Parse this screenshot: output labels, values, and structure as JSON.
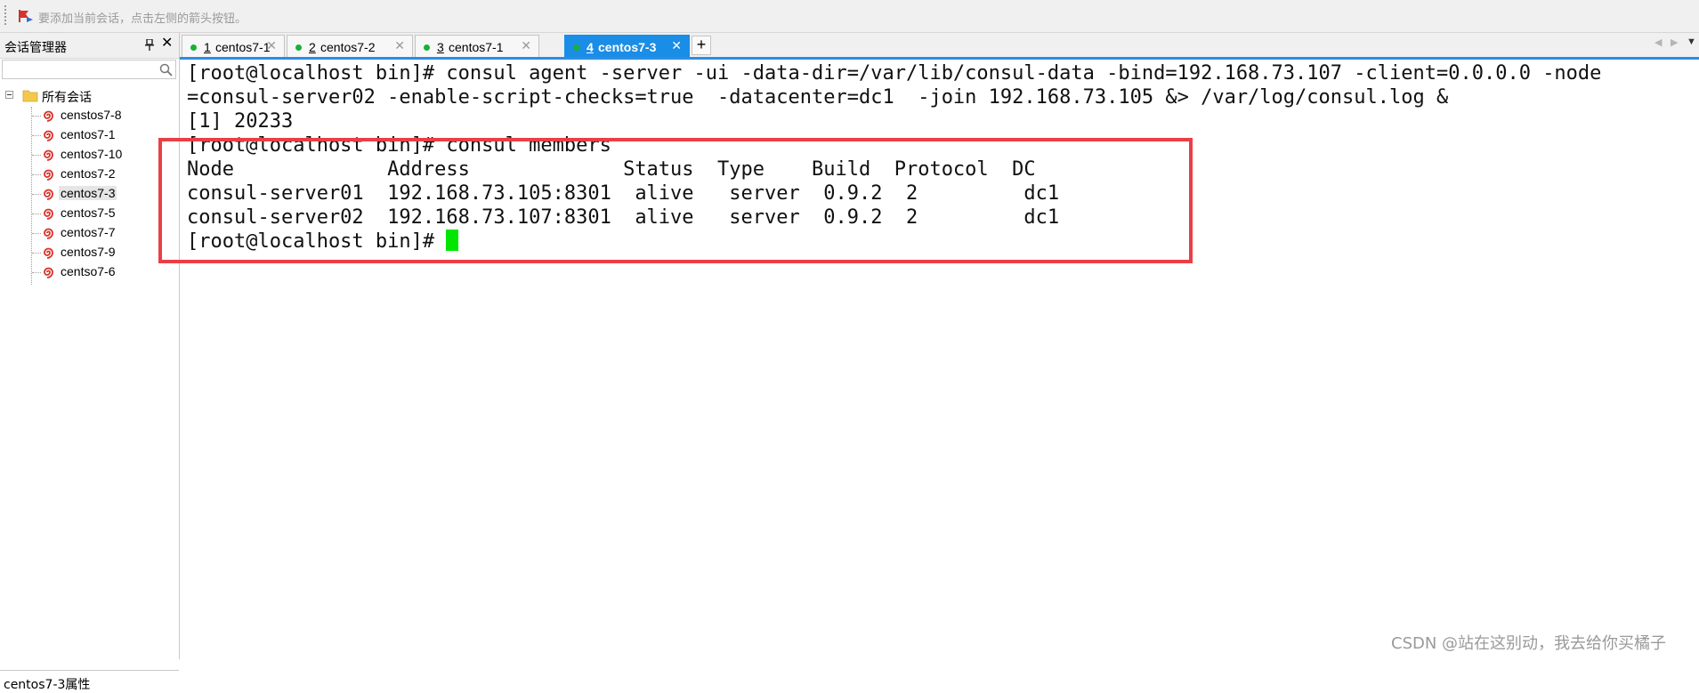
{
  "topbar": {
    "hint": "要添加当前会话，点击左侧的箭头按钮。"
  },
  "session_manager": {
    "title": "会话管理器",
    "search_placeholder": "",
    "root_label": "所有会话",
    "sessions": [
      {
        "label": "censtos7-8",
        "selected": false
      },
      {
        "label": "centos7-1",
        "selected": false
      },
      {
        "label": "centos7-10",
        "selected": false
      },
      {
        "label": "centos7-2",
        "selected": false
      },
      {
        "label": "centos7-3",
        "selected": true
      },
      {
        "label": "centos7-5",
        "selected": false
      },
      {
        "label": "centos7-7",
        "selected": false
      },
      {
        "label": "centos7-9",
        "selected": false
      },
      {
        "label": "centso7-6",
        "selected": false
      }
    ],
    "properties_label": "centos7-3属性"
  },
  "tabs": [
    {
      "num": "1",
      "label": "centos7-1",
      "active": false
    },
    {
      "num": "2",
      "label": "centos7-2",
      "active": false
    },
    {
      "num": "3",
      "label": "centos7-1",
      "active": false
    },
    {
      "num": "4",
      "label": "centos7-3",
      "active": true
    }
  ],
  "add_tab_label": "+",
  "terminal": {
    "lines": [
      "[root@localhost bin]# consul agent -server -ui -data-dir=/var/lib/consul-data -bind=192.168.73.107 -client=0.0.0.0 -node",
      "=consul-server02 -enable-script-checks=true  -datacenter=dc1  -join 192.168.73.105 &> /var/log/consul.log &",
      "[1] 20233",
      "[root@localhost bin]# consul members",
      "Node             Address             Status  Type    Build  Protocol  DC",
      "consul-server01  192.168.73.105:8301  alive   server  0.9.2  2         dc1",
      "consul-server02  192.168.73.107:8301  alive   server  0.9.2  2         dc1",
      "[root@localhost bin]# "
    ]
  },
  "watermark": "CSDN @站在这别动，我去给你买橘子",
  "colors": {
    "accent": "#1a8de6",
    "highlight_box": "#ea3f45",
    "cursor": "#00e600",
    "status_dot": "#19b233"
  }
}
